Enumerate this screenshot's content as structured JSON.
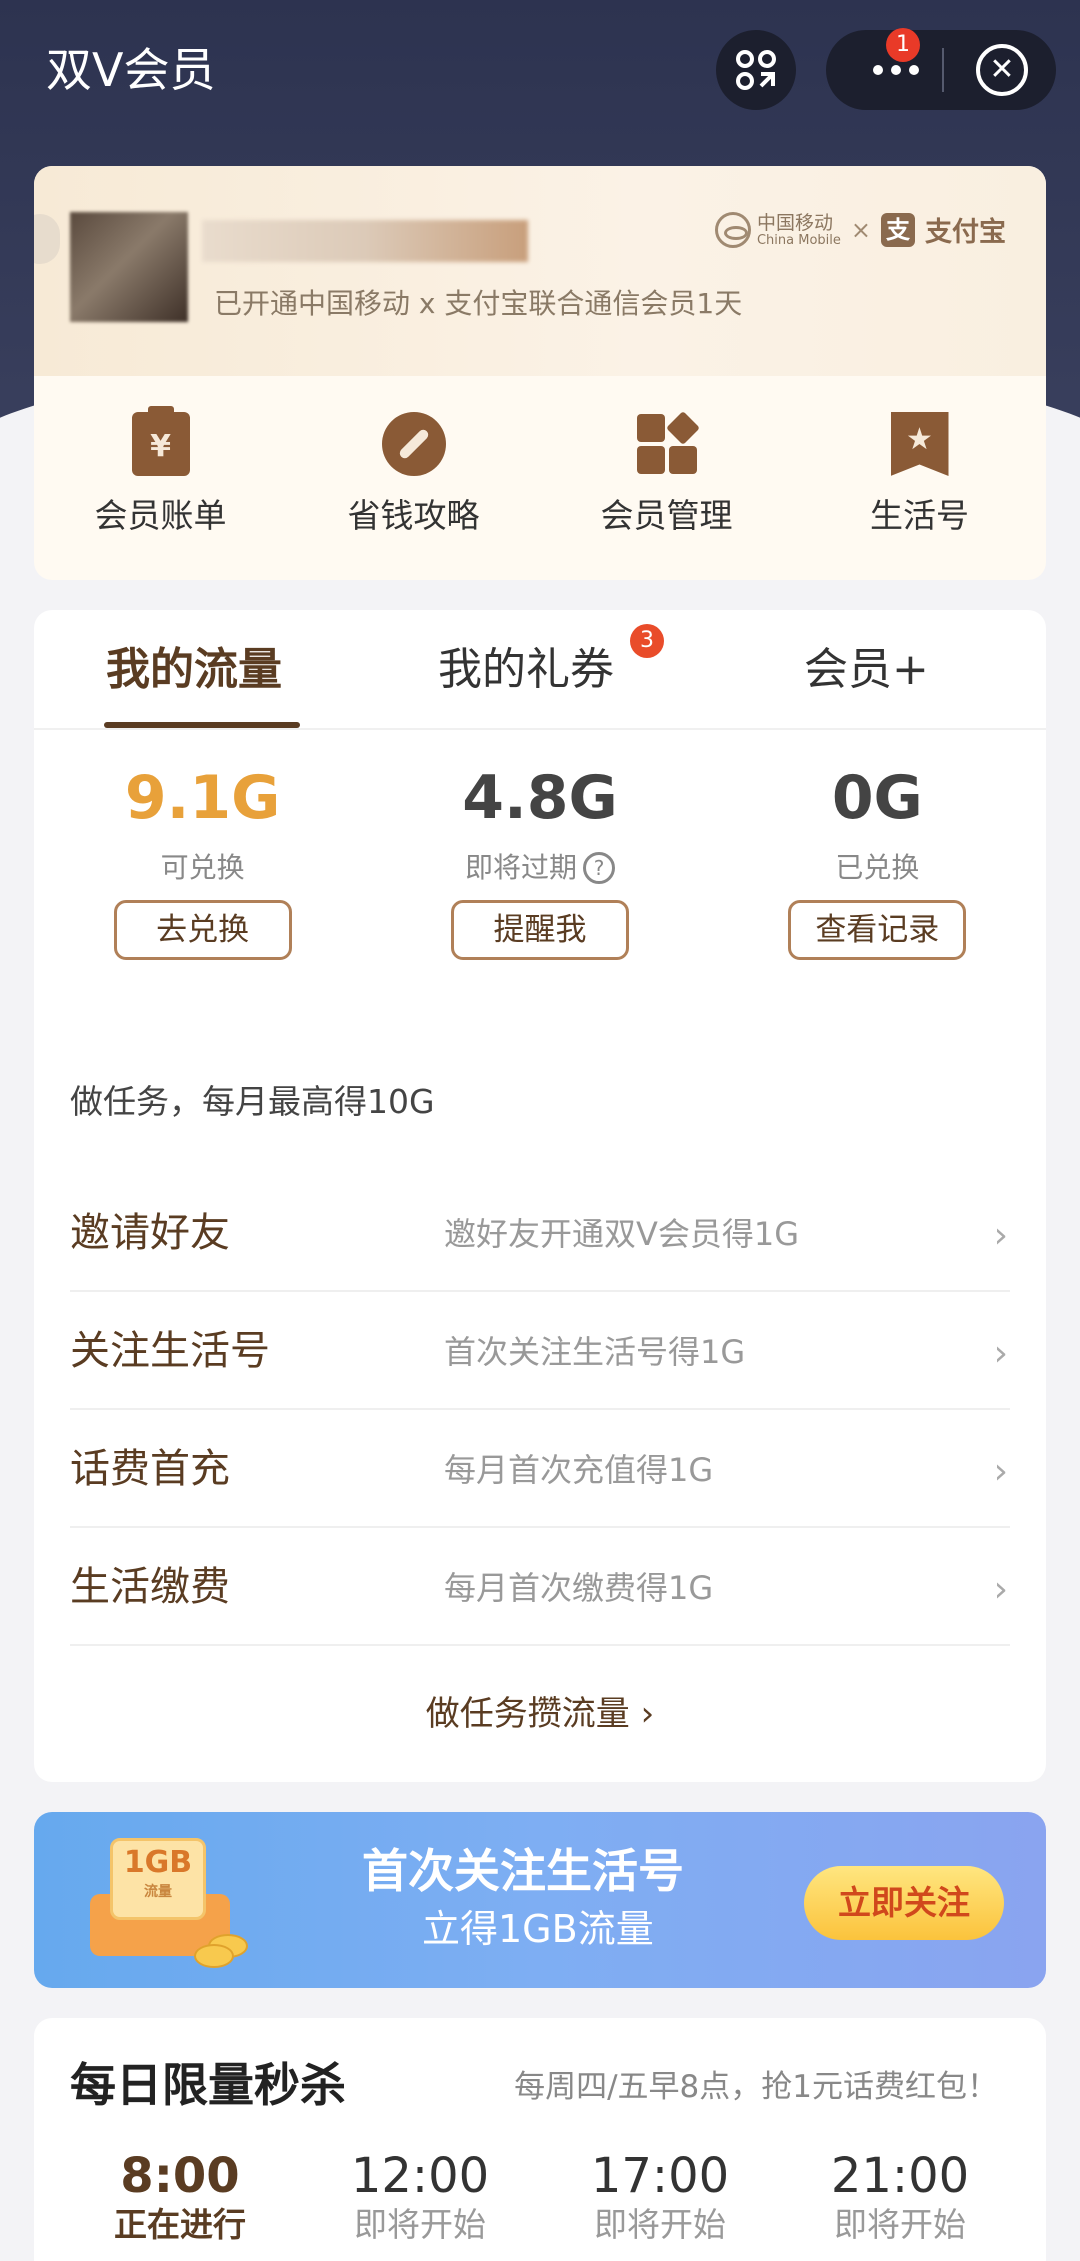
{
  "nav": {
    "title": "双V会员",
    "badge_count": "1",
    "icons": [
      "scan-icon",
      "more-dots-icon",
      "close-icon"
    ]
  },
  "member": {
    "description": "已开通中国移动 x 支付宝联合通信会员1天",
    "brand": {
      "china_mobile_cn": "中国移动",
      "china_mobile_en": "China Mobile",
      "times": "×",
      "alipay_glyph": "支",
      "alipay_name": "支付宝"
    },
    "menu": [
      {
        "label": "会员账单",
        "icon": "bill-icon",
        "glyph": "¥"
      },
      {
        "label": "省钱攻略",
        "icon": "compass-icon"
      },
      {
        "label": "会员管理",
        "icon": "apps-grid-icon"
      },
      {
        "label": "生活号",
        "icon": "bookmark-star-icon",
        "glyph": "★"
      }
    ]
  },
  "tabs": [
    {
      "label": "我的流量",
      "active": true
    },
    {
      "label": "我的礼券",
      "badge": "3"
    },
    {
      "label": "会员+"
    }
  ],
  "stats": [
    {
      "value": "9.1G",
      "label": "可兑换",
      "button": "去兑换",
      "color": "#e8a13a"
    },
    {
      "value": "4.8G",
      "label": "即将过期",
      "help": "?",
      "button": "提醒我"
    },
    {
      "value": "0G",
      "label": "已兑换",
      "button": "查看记录"
    }
  ],
  "tasks": {
    "title": "做任务，每月最高得10G",
    "items": [
      {
        "name": "邀请好友",
        "desc": "邀好友开通双V会员得1G"
      },
      {
        "name": "关注生活号",
        "desc": "首次关注生活号得1G"
      },
      {
        "name": "话费首充",
        "desc": "每月首次充值得1G"
      },
      {
        "name": "生活缴费",
        "desc": "每月首次缴费得1G"
      }
    ],
    "more_link": "做任务攒流量 ›",
    "chevron": "›"
  },
  "banner": {
    "gift_card": "1GB",
    "gift_card_sub": "流量",
    "title": "首次关注生活号",
    "subtitle": "立得1GB流量",
    "button": "立即关注"
  },
  "flash_sale": {
    "title": "每日限量秒杀",
    "subtitle": "每周四/五早8点，抢1元话费红包！",
    "slots": [
      {
        "time": "8:00",
        "status": "正在进行",
        "active": true
      },
      {
        "time": "12:00",
        "status": "即将开始"
      },
      {
        "time": "17:00",
        "status": "即将开始"
      },
      {
        "time": "21:00",
        "status": "即将开始"
      }
    ]
  },
  "colors": {
    "header_bg": "#2d3350",
    "brown_accent": "#5a3c22",
    "orange_value": "#e8a13a",
    "banner_blue": "#6fa9f0",
    "badge_red": "#e93a28"
  }
}
